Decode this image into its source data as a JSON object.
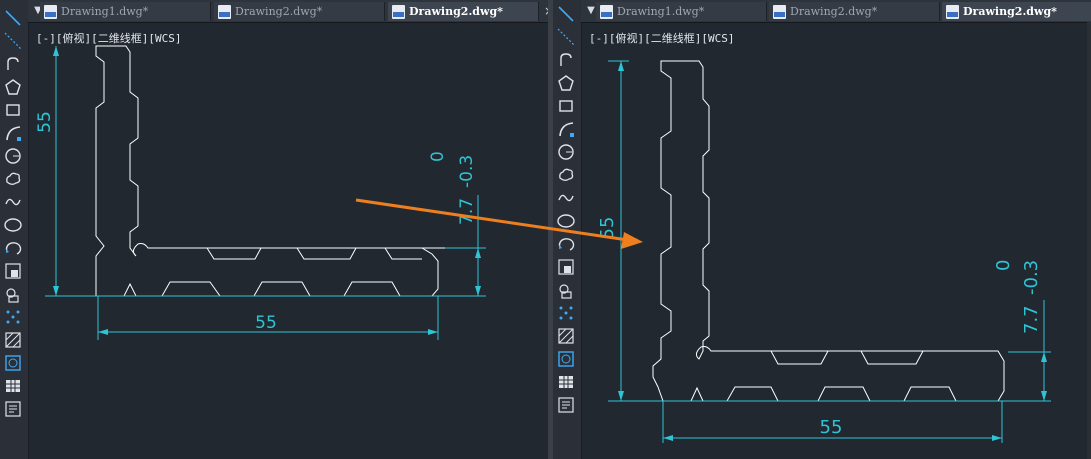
{
  "left_panel": {
    "tabs": [
      {
        "label": "Drawing1.dwg*",
        "active": false
      },
      {
        "label": "Drawing2.dwg*",
        "active": false
      },
      {
        "label": "Drawing2.dwg*",
        "active": true
      }
    ],
    "tab_close": "×",
    "view_controls": {
      "viewport": "[-]",
      "view": "[俯视]",
      "style": "[二维线框]",
      "ucs": "[WCS]"
    },
    "dimensions": {
      "height": "55",
      "width": "55",
      "thickness": "7.7",
      "upper_tol": "0",
      "lower_tol": "-0.3"
    }
  },
  "right_panel": {
    "tabs": [
      {
        "label": "Drawing1.dwg*",
        "active": false
      },
      {
        "label": "Drawing2.dwg*",
        "active": false
      },
      {
        "label": "Drawing2.dwg*",
        "active": true
      }
    ],
    "view_controls": {
      "viewport": "[-]",
      "view": "[俯视]",
      "style": "[二维线框]",
      "ucs": "[WCS]"
    },
    "dimensions": {
      "height": "55",
      "width": "55",
      "thickness": "7.7",
      "upper_tol": "0",
      "lower_tol": "-0.3"
    }
  },
  "tab_toggle": "▼",
  "toolbar_tools": [
    "line-icon",
    "construction-line-icon",
    "polyline-icon",
    "polygon-icon",
    "rectangle-icon",
    "arc-icon",
    "circle-icon",
    "revision-cloud-icon",
    "spline-icon",
    "ellipse-icon",
    "ellipse-arc-icon",
    "insert-block-icon",
    "make-block-icon",
    "point-icon",
    "hatch-icon",
    "region-icon",
    "table-icon",
    "multiline-text-icon"
  ],
  "colors": {
    "background": "#212830",
    "geometry": "#ffffff",
    "dimension": "#2ec4d6",
    "arrow": "#ee7f1e",
    "toolbar": "#2b3038"
  }
}
